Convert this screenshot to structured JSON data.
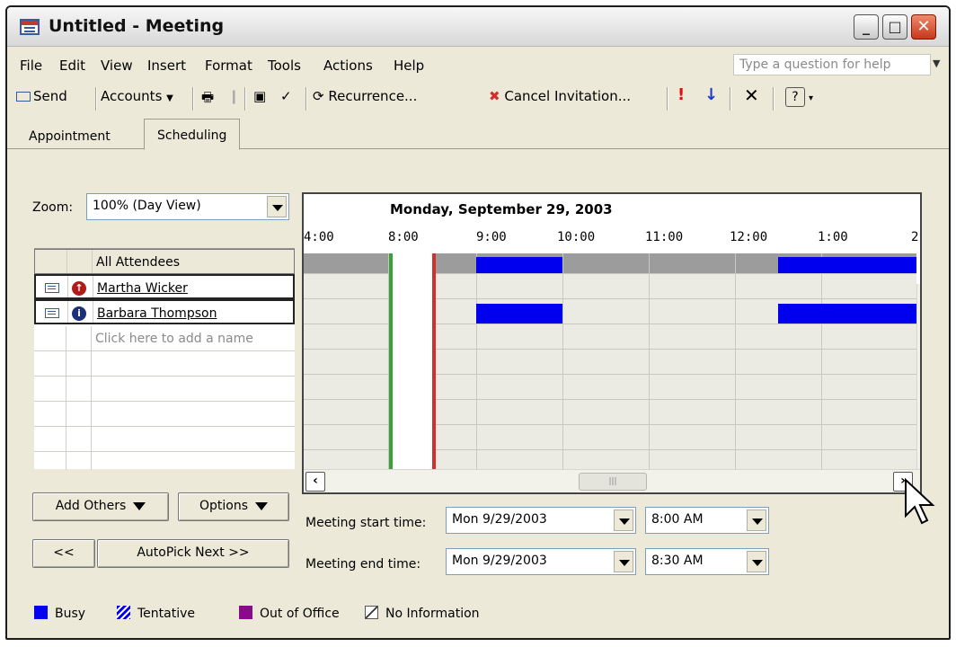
{
  "window": {
    "title": "Untitled - Meeting"
  },
  "menu": {
    "items": [
      "File",
      "Edit",
      "View",
      "Insert",
      "Format",
      "Tools",
      "Actions",
      "Help"
    ],
    "help_placeholder": "Type a question for help"
  },
  "toolbar": {
    "send": "Send",
    "accounts": "Accounts",
    "recurrence": "Recurrence...",
    "cancel_invitation": "Cancel Invitation...",
    "importance_high": "!",
    "importance_low": "↓"
  },
  "tabs": [
    "Appointment",
    "Scheduling"
  ],
  "zoom": {
    "label": "Zoom:",
    "value": "100% (Day View)"
  },
  "attendees": {
    "header": "All Attendees",
    "rows": [
      {
        "name": "Martha Wicker",
        "icon": "required-attendee-icon",
        "color": "#b01c1c",
        "glyph": "↑"
      },
      {
        "name": "Barbara Thompson",
        "icon": "optional-attendee-icon",
        "color": "#1c2f7a",
        "glyph": "i"
      }
    ],
    "add_placeholder": "Click here to add a name"
  },
  "schedule": {
    "date": "Monday, September 29, 2003",
    "times": [
      "4:00",
      "8:00",
      "9:00",
      "10:00",
      "11:00",
      "12:00",
      "1:00",
      "2"
    ]
  },
  "buttons": {
    "add_others": "Add Others",
    "options": "Options",
    "prev": "<<",
    "autopick": "AutoPick Next >>"
  },
  "meeting": {
    "start_label": "Meeting start time:",
    "start_date": "Mon 9/29/2003",
    "start_time": "8:00 AM",
    "end_label": "Meeting end time:",
    "end_date": "Mon 9/29/2003",
    "end_time": "8:30 AM"
  },
  "legend": {
    "busy": "Busy",
    "tentative": "Tentative",
    "out_of_office": "Out of Office",
    "no_information": "No Information",
    "colors": {
      "busy": "#0000ee",
      "tentative": "#0000ee",
      "out_of_office": "#8b0a8b"
    }
  }
}
